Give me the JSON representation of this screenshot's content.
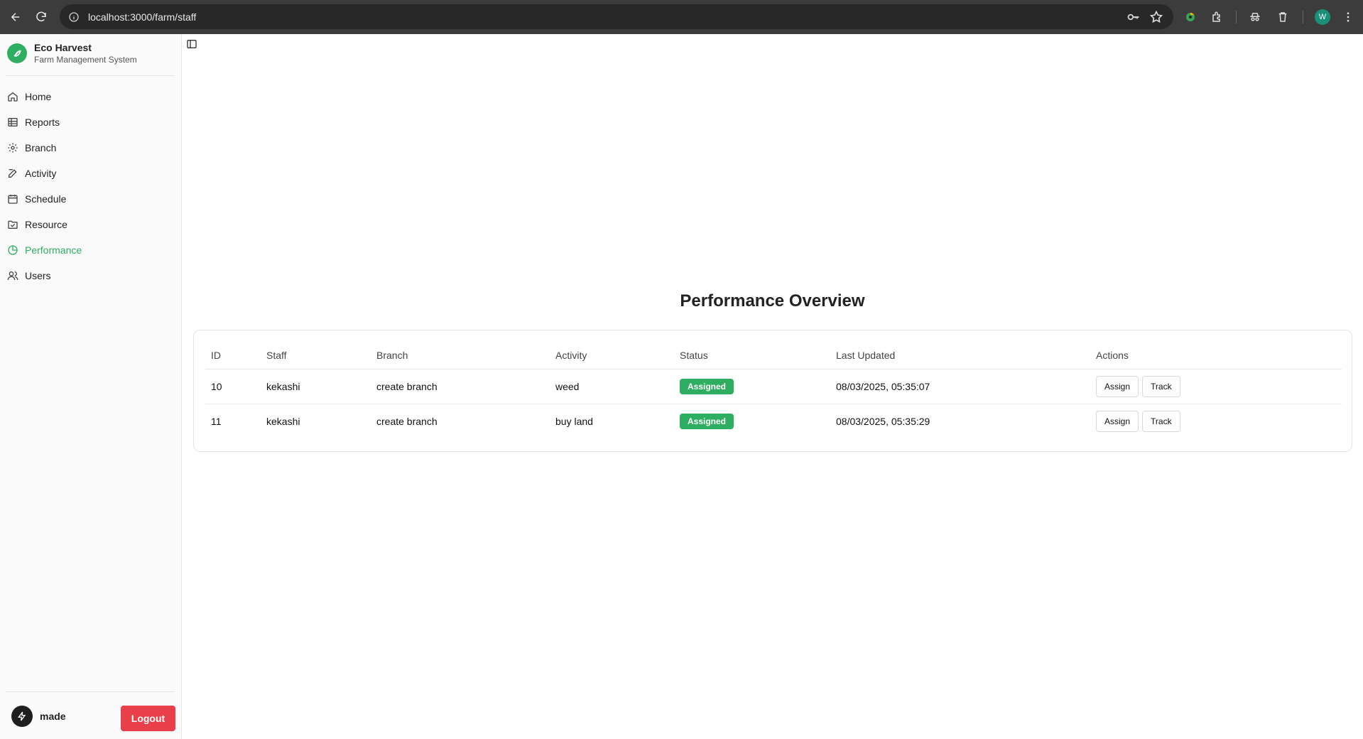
{
  "browser": {
    "url": "localhost:3000/farm/staff",
    "profile_initial": "W"
  },
  "sidebar": {
    "brand_title": "Eco Harvest",
    "brand_subtitle": "Farm Management System",
    "items": [
      {
        "label": "Home",
        "icon": "home-icon"
      },
      {
        "label": "Reports",
        "icon": "table-icon"
      },
      {
        "label": "Branch",
        "icon": "gear-icon"
      },
      {
        "label": "Activity",
        "icon": "edit-icon"
      },
      {
        "label": "Schedule",
        "icon": "calendar-icon"
      },
      {
        "label": "Resource",
        "icon": "folder-icon"
      },
      {
        "label": "Performance",
        "icon": "pie-chart-icon",
        "active": true
      },
      {
        "label": "Users",
        "icon": "users-icon"
      }
    ],
    "user_name": "made",
    "logout_label": "Logout"
  },
  "main": {
    "title": "Performance Overview",
    "columns": [
      "ID",
      "Staff",
      "Branch",
      "Activity",
      "Status",
      "Last Updated",
      "Actions"
    ],
    "rows": [
      {
        "id": "10",
        "staff": "kekashi",
        "branch": "create branch",
        "activity": "weed",
        "status": "Assigned",
        "updated": "08/03/2025, 05:35:07",
        "assign": "Assign",
        "track": "Track"
      },
      {
        "id": "11",
        "staff": "kekashi",
        "branch": "create branch",
        "activity": "buy land",
        "status": "Assigned",
        "updated": "08/03/2025, 05:35:29",
        "assign": "Assign",
        "track": "Track"
      }
    ]
  },
  "colors": {
    "accent": "#2eae60",
    "logout": "#e83f4b"
  }
}
